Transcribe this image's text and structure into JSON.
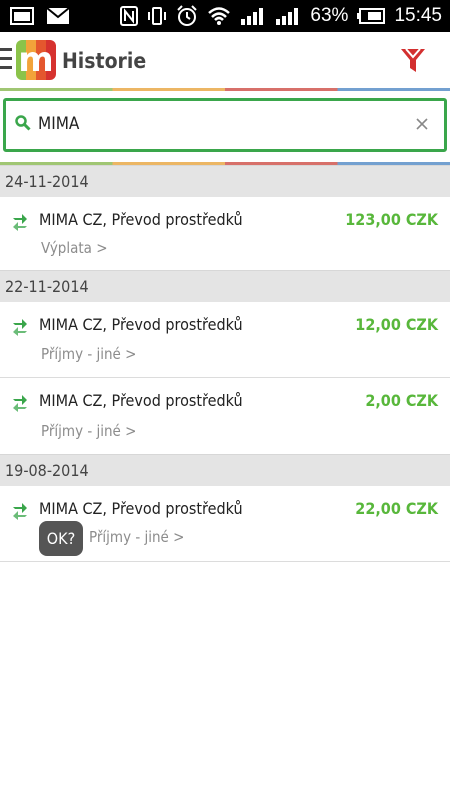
{
  "status_bar": {
    "battery": "63%",
    "time": "15:45"
  },
  "app": {
    "title": "Historie",
    "logo_letter": "m"
  },
  "search": {
    "value": "MIMA"
  },
  "groups": [
    {
      "date": "24-11-2014",
      "transactions": [
        {
          "name": "MIMA CZ, Převod prostředků",
          "amount": "123,00 CZK",
          "category": "Výplata >"
        }
      ]
    },
    {
      "date": "22-11-2014",
      "transactions": [
        {
          "name": "MIMA CZ, Převod prostředků",
          "amount": "12,00 CZK",
          "category": "Příjmy - jiné >"
        },
        {
          "name": "MIMA CZ, Převod prostředků",
          "amount": "2,00 CZK",
          "category": "Příjmy - jiné >"
        }
      ]
    },
    {
      "date": "19-08-2014",
      "transactions": [
        {
          "name": "MIMA CZ, Převod prostředků",
          "amount": "22,00 CZK",
          "category": "Příjmy - jiné >",
          "badge": "OK?"
        }
      ]
    }
  ],
  "colors": {
    "accent_green": "#3aa64b",
    "amount_green": "#58b73b",
    "filter_red": "#d32f2f"
  }
}
